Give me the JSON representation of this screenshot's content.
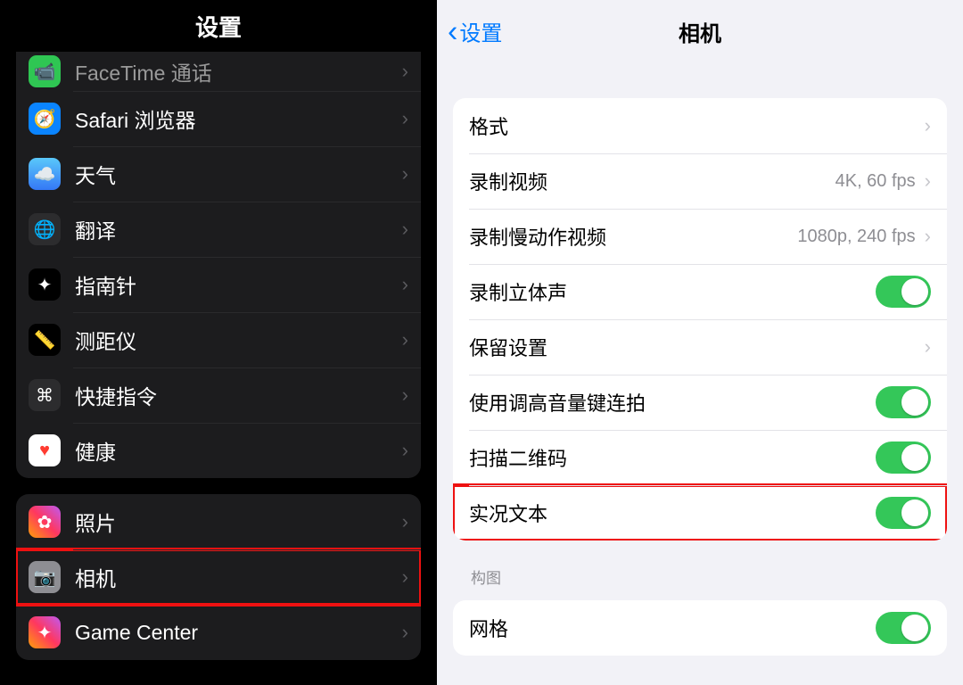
{
  "left": {
    "title": "设置",
    "group1": [
      {
        "label": "FaceTime 通话",
        "icon": "📹",
        "bg": "bg-green",
        "name": "row-facetime"
      },
      {
        "label": "Safari 浏览器",
        "icon": "🧭",
        "bg": "bg-blue",
        "name": "row-safari"
      },
      {
        "label": "天气",
        "icon": "☁️",
        "bg": "bg-sky",
        "name": "row-weather"
      },
      {
        "label": "翻译",
        "icon": "🌐",
        "bg": "bg-dark",
        "name": "row-translate"
      },
      {
        "label": "指南针",
        "icon": "✦",
        "bg": "bg-black",
        "name": "row-compass"
      },
      {
        "label": "测距仪",
        "icon": "📏",
        "bg": "bg-black",
        "name": "row-measure"
      },
      {
        "label": "快捷指令",
        "icon": "⌘",
        "bg": "bg-dark",
        "name": "row-shortcuts"
      },
      {
        "label": "健康",
        "icon": "♥",
        "bg": "bg-white",
        "name": "row-health"
      }
    ],
    "group2": [
      {
        "label": "照片",
        "icon": "✿",
        "bg": "bg-multi",
        "name": "row-photos"
      },
      {
        "label": "相机",
        "icon": "📷",
        "bg": "bg-gray",
        "name": "row-camera",
        "highlight": true
      },
      {
        "label": "Game Center",
        "icon": "✦",
        "bg": "bg-multi",
        "name": "row-gamecenter"
      }
    ]
  },
  "right": {
    "back": "设置",
    "title": "相机",
    "rows": [
      {
        "label": "格式",
        "type": "chevron",
        "name": "row-format"
      },
      {
        "label": "录制视频",
        "type": "value-chevron",
        "value": "4K, 60 fps",
        "name": "row-record-video"
      },
      {
        "label": "录制慢动作视频",
        "type": "value-chevron",
        "value": "1080p, 240 fps",
        "name": "row-record-slomo"
      },
      {
        "label": "录制立体声",
        "type": "toggle",
        "on": true,
        "name": "row-stereo"
      },
      {
        "label": "保留设置",
        "type": "chevron",
        "name": "row-preserve"
      },
      {
        "label": "使用调高音量键连拍",
        "type": "toggle",
        "on": true,
        "name": "row-volume-burst"
      },
      {
        "label": "扫描二维码",
        "type": "toggle",
        "on": true,
        "name": "row-qr"
      },
      {
        "label": "实况文本",
        "type": "toggle",
        "on": true,
        "name": "row-live-text",
        "highlight": true
      }
    ],
    "sectionTitle": "构图",
    "rows2": [
      {
        "label": "网格",
        "type": "toggle",
        "on": true,
        "name": "row-grid"
      }
    ]
  }
}
